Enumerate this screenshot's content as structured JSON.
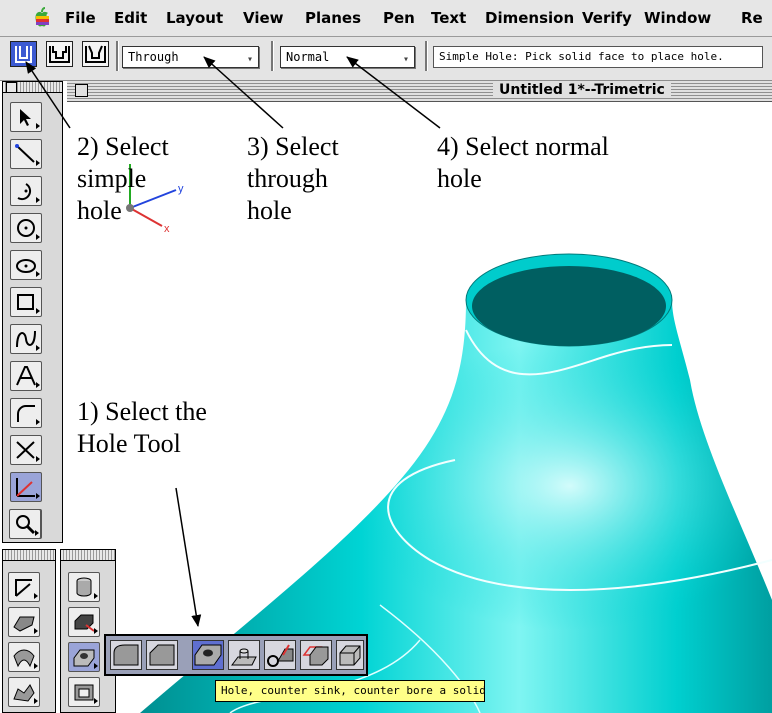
{
  "menubar": {
    "items": [
      "File",
      "Edit",
      "Layout",
      "View",
      "Planes",
      "Pen",
      "Text",
      "Dimension",
      "Verify",
      "Window",
      "Re"
    ]
  },
  "toolbar": {
    "hole_buttons": [
      "simple-hole",
      "counterbore-hole",
      "countersink-hole"
    ],
    "depth_select": "Through",
    "type_select": "Normal",
    "status": "Simple Hole: Pick solid face to place hole."
  },
  "window": {
    "title": "Untitled 1*--Trimetric"
  },
  "annotations": {
    "step1": [
      "1) Select the",
      "Hole Tool"
    ],
    "step2": [
      "2) Select",
      "simple",
      "hole"
    ],
    "step3": [
      "3) Select",
      "through",
      "hole"
    ],
    "step4": [
      "4) Select normal",
      "hole"
    ]
  },
  "axes": {
    "x": "x",
    "y": "y"
  },
  "tooltip": "Hole, counter sink, counter bore a solid",
  "colors": {
    "surface": "#00c8c8",
    "selection": "#3c5ad2",
    "tooltip": "#ffff88"
  }
}
